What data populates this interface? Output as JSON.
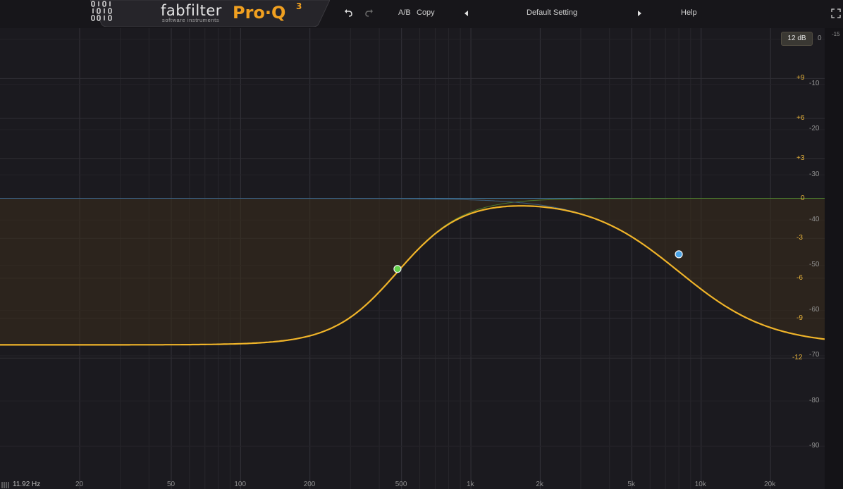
{
  "header": {
    "brand": "fabfilter",
    "brand_sub": "software instruments",
    "product": "Pro·Q",
    "product_version": "3",
    "ab_label": "A/B",
    "copy_label": "Copy",
    "preset_name": "Default Setting",
    "help_label": "Help"
  },
  "range_button": "12 dB",
  "meter_top_label": "-15",
  "gain_scale": [
    {
      "label": "+9",
      "db": 9
    },
    {
      "label": "+6",
      "db": 6
    },
    {
      "label": "+3",
      "db": 3
    },
    {
      "label": "0",
      "db": 0
    },
    {
      "label": "-3",
      "db": -3
    },
    {
      "label": "-6",
      "db": -6
    },
    {
      "label": "-9",
      "db": -9
    },
    {
      "label": "-12",
      "db": -12
    }
  ],
  "spectrum_scale": [
    "0",
    "-10",
    "-20",
    "-30",
    "-40",
    "-50",
    "-60",
    "-70",
    "-80",
    "-90"
  ],
  "freq_scale": [
    {
      "label": "20",
      "hz": 20
    },
    {
      "label": "50",
      "hz": 50
    },
    {
      "label": "100",
      "hz": 100
    },
    {
      "label": "200",
      "hz": 200
    },
    {
      "label": "500",
      "hz": 500
    },
    {
      "label": "1k",
      "hz": 1000
    },
    {
      "label": "2k",
      "hz": 2000
    },
    {
      "label": "5k",
      "hz": 5000
    },
    {
      "label": "10k",
      "hz": 10000
    },
    {
      "label": "20k",
      "hz": 20000
    }
  ],
  "freq_readout": "11.92 Hz",
  "bands": [
    {
      "name": "band-1",
      "type": "high-shelf-cut",
      "freq_hz": 480,
      "gain_db": -5.3,
      "color": "#63d24a"
    },
    {
      "name": "band-2",
      "type": "low-shelf-cut",
      "freq_hz": 8000,
      "gain_db": -4.2,
      "color": "#4aa3e6"
    }
  ],
  "colors": {
    "background": "#1b1a1f",
    "curve": "#f0b429",
    "grid": "#2f2e33",
    "gain_label": "#e8b33a",
    "zero_line": "#3b6f95"
  }
}
